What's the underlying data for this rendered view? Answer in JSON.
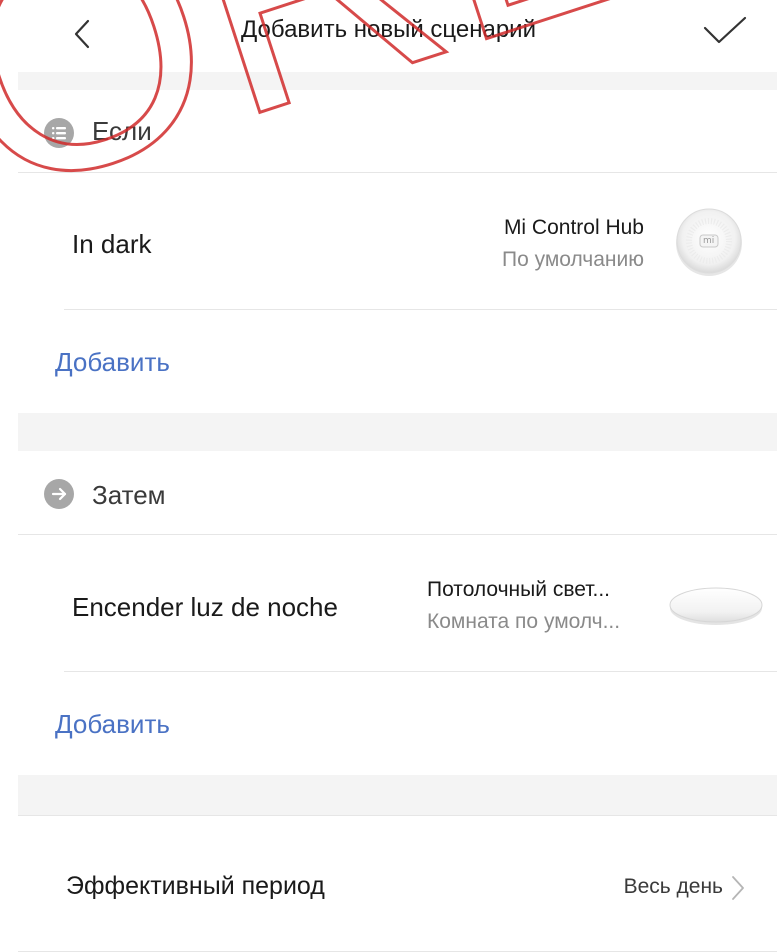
{
  "header": {
    "title": "Добавить новый сценарий",
    "back_icon": "chevron-left-icon",
    "confirm_icon": "checkmark-icon"
  },
  "if_section": {
    "label": "Если",
    "icon": "list-icon",
    "condition": {
      "title": "In dark",
      "device_name": "Mi Control Hub",
      "device_room": "По умолчанию",
      "device_logo_text": "mi"
    },
    "add_label": "Добавить"
  },
  "then_section": {
    "label": "Затем",
    "icon": "arrow-right-icon",
    "action": {
      "title": "Encender luz de noche",
      "device_name": "Потолочный свет...",
      "device_room": "Комната по умолч..."
    },
    "add_label": "Добавить"
  },
  "period": {
    "label": "Эффективный период",
    "value": "Весь день"
  },
  "watermark": {
    "text": "ORE.D"
  },
  "colors": {
    "accent": "#4a72c4",
    "icon_gray": "#a7a7a7",
    "band_gray": "#f4f4f4"
  }
}
